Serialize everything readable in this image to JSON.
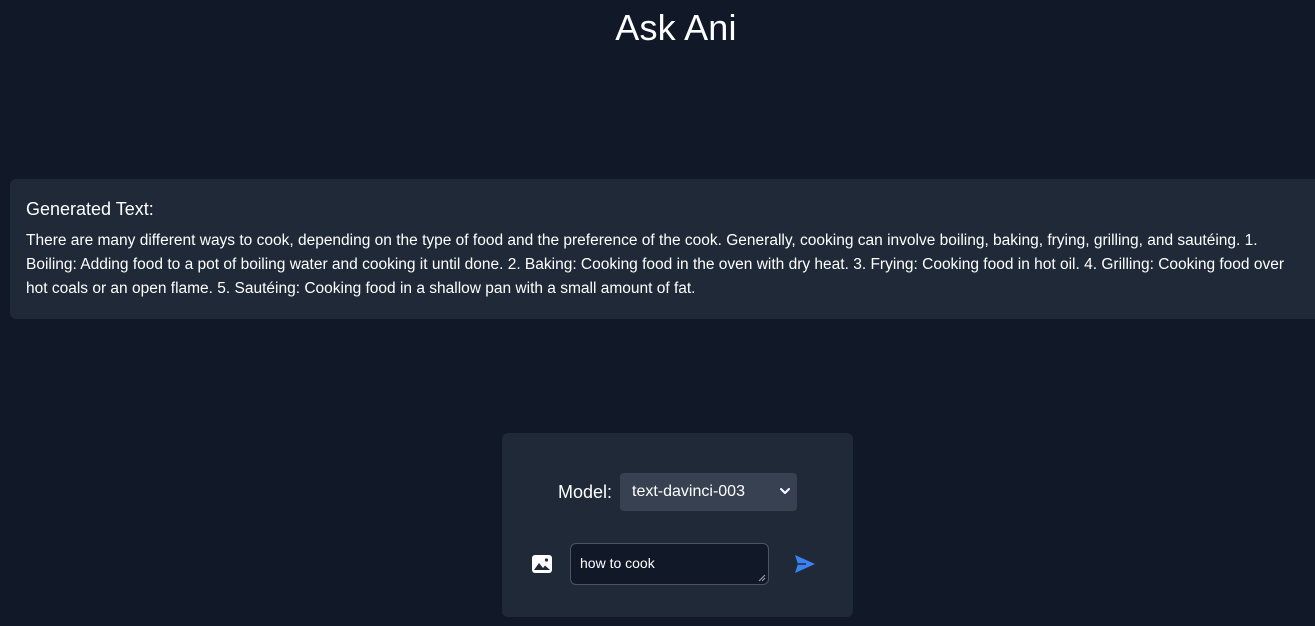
{
  "header": {
    "title": "Ask Ani"
  },
  "result": {
    "heading": "Generated Text:",
    "body": "There are many different ways to cook, depending on the type of food and the preference of the cook. Generally, cooking can involve boiling, baking, frying, grilling, and sautéing. 1. Boiling: Adding food to a pot of boiling water and cooking it until done. 2. Baking: Cooking food in the oven with dry heat. 3. Frying: Cooking food in hot oil. 4. Grilling: Cooking food over hot coals or an open flame. 5. Sautéing: Cooking food in a shallow pan with a small amount of fat."
  },
  "controls": {
    "model_label": "Model:",
    "model_selected": "text-davinci-003",
    "prompt_value": "how to cook",
    "image_icon": "image-icon",
    "send_icon": "send-icon",
    "chevron_icon": "chevron-down-icon"
  },
  "colors": {
    "background": "#111827",
    "panel": "#1f2937",
    "select": "#374151",
    "accent": "#3b82f6"
  }
}
